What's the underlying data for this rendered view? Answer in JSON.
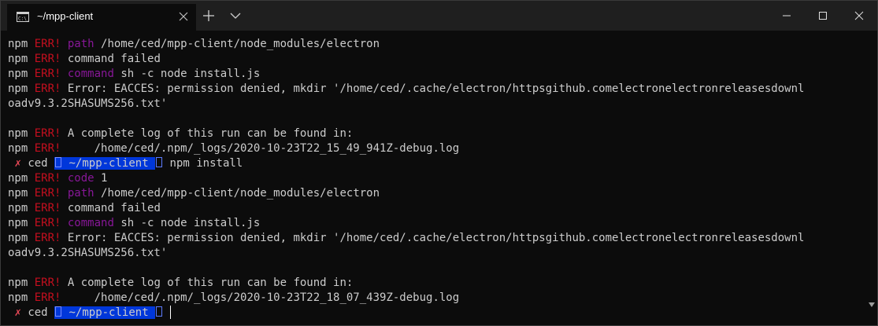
{
  "window": {
    "tab_title": "~/mpp-client",
    "icon_names": [
      "terminal-icon",
      "close-icon",
      "plus-icon",
      "chevron-down-icon",
      "minimize-icon",
      "maximize-icon",
      "window-close-icon"
    ]
  },
  "terminal": {
    "prompt": {
      "status_mark": "✗",
      "user": "ced",
      "path": "~/mpp-client"
    },
    "lines": [
      {
        "prefix": "npm ",
        "tag": "ERR!",
        "key": "path",
        "text": " /home/ced/mpp-client/node_modules/electron"
      },
      {
        "prefix": "npm ",
        "tag": "ERR!",
        "key": "",
        "text": " command failed"
      },
      {
        "prefix": "npm ",
        "tag": "ERR!",
        "key": "command",
        "text": " sh -c node install.js"
      },
      {
        "prefix": "npm ",
        "tag": "ERR!",
        "key": "",
        "text": " Error: EACCES: permission denied, mkdir '/home/ced/.cache/electron/httpsgithub.comelectronelectronreleasesdownl"
      },
      {
        "prefix": "",
        "tag": "",
        "key": "",
        "text": "oadv9.3.2SHASUMS256.txt'"
      },
      {
        "prefix": "",
        "tag": "",
        "key": "",
        "text": ""
      },
      {
        "prefix": "npm ",
        "tag": "ERR!",
        "key": "",
        "text": " A complete log of this run can be found in:"
      },
      {
        "prefix": "npm ",
        "tag": "ERR!",
        "key": "",
        "text": "     /home/ced/.npm/_logs/2020-10-23T22_15_49_941Z-debug.log"
      },
      {
        "prompt": true,
        "command": "npm install"
      },
      {
        "prefix": "npm ",
        "tag": "ERR!",
        "key": "code",
        "text": " 1"
      },
      {
        "prefix": "npm ",
        "tag": "ERR!",
        "key": "path",
        "text": " /home/ced/mpp-client/node_modules/electron"
      },
      {
        "prefix": "npm ",
        "tag": "ERR!",
        "key": "",
        "text": " command failed"
      },
      {
        "prefix": "npm ",
        "tag": "ERR!",
        "key": "command",
        "text": " sh -c node install.js"
      },
      {
        "prefix": "npm ",
        "tag": "ERR!",
        "key": "",
        "text": " Error: EACCES: permission denied, mkdir '/home/ced/.cache/electron/httpsgithub.comelectronelectronreleasesdownl"
      },
      {
        "prefix": "",
        "tag": "",
        "key": "",
        "text": "oadv9.3.2SHASUMS256.txt'"
      },
      {
        "prefix": "",
        "tag": "",
        "key": "",
        "text": ""
      },
      {
        "prefix": "npm ",
        "tag": "ERR!",
        "key": "",
        "text": " A complete log of this run can be found in:"
      },
      {
        "prefix": "npm ",
        "tag": "ERR!",
        "key": "",
        "text": "     /home/ced/.npm/_logs/2020-10-23T22_18_07_439Z-debug.log"
      },
      {
        "prompt": true,
        "command": "",
        "cursor": true
      }
    ]
  },
  "colors": {
    "background": "#0c0c0c",
    "titlebar": "#1f1f1f",
    "foreground": "#cccccc",
    "err": "#c50f1f",
    "keyword": "#881798",
    "path_segment": "#0037da",
    "status_mark": "#e74856"
  }
}
